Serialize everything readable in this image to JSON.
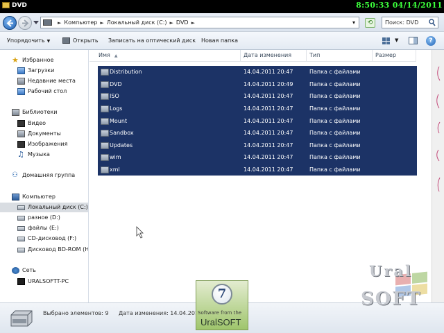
{
  "window": {
    "title": "DVD",
    "clock": "8:50:33  04/14/2011"
  },
  "address": {
    "crumbs": [
      "Компьютер",
      "Локальный диск (C:)",
      "DVD"
    ],
    "search_placeholder": "Поиск: DVD"
  },
  "toolbar": {
    "organize": "Упорядочить",
    "open": "Открыть",
    "burn": "Записать на оптический диск",
    "new_folder": "Новая папка"
  },
  "nav": {
    "favorites": {
      "label": "Избранное",
      "items": [
        "Загрузки",
        "Недавние места",
        "Рабочий стол"
      ]
    },
    "libraries": {
      "label": "Библиотеки",
      "items": [
        "Видео",
        "Документы",
        "Изображения",
        "Музыка"
      ]
    },
    "homegroup": "Домашняя группа",
    "computer": {
      "label": "Компьютер",
      "items": [
        "Локальный диск (C:)",
        "разное (D:)",
        "файлы (E:)",
        "CD-дисковод (F:)",
        "Дисковод BD-ROM (H"
      ]
    },
    "network": {
      "label": "Сеть",
      "items": [
        "URALSOFTT-PC"
      ]
    }
  },
  "columns": {
    "name": "Имя",
    "date": "Дата изменения",
    "type": "Тип",
    "size": "Размер"
  },
  "files": [
    {
      "name": "Distribution",
      "date": "14.04.2011 20:47",
      "type": "Папка с файлами"
    },
    {
      "name": "DVD",
      "date": "14.04.2011 20:49",
      "type": "Папка с файлами"
    },
    {
      "name": "ISO",
      "date": "14.04.2011 20:47",
      "type": "Папка с файлами"
    },
    {
      "name": "Logs",
      "date": "14.04.2011 20:47",
      "type": "Папка с файлами"
    },
    {
      "name": "Mount",
      "date": "14.04.2011 20:47",
      "type": "Папка с файлами"
    },
    {
      "name": "Sandbox",
      "date": "14.04.2011 20:47",
      "type": "Папка с файлами"
    },
    {
      "name": "Updates",
      "date": "14.04.2011 20:47",
      "type": "Папка с файлами"
    },
    {
      "name": "wim",
      "date": "14.04.2011 20:47",
      "type": "Папка с файлами"
    },
    {
      "name": "xml",
      "date": "14.04.2011 20:47",
      "type": "Папка с файлами"
    }
  ],
  "status": {
    "selected": "Выбрано элементов: 9",
    "date": "Дата изменения: 14.04.2011"
  },
  "logo": {
    "number": "7",
    "tagline": "Software from the",
    "name": "UralSOFT"
  },
  "watermark": {
    "line1": "Ural",
    "line2": "SOFT"
  },
  "colors": {
    "selection": "#1c3366",
    "clock": "#3cff3c",
    "titlebar": "#000000"
  }
}
